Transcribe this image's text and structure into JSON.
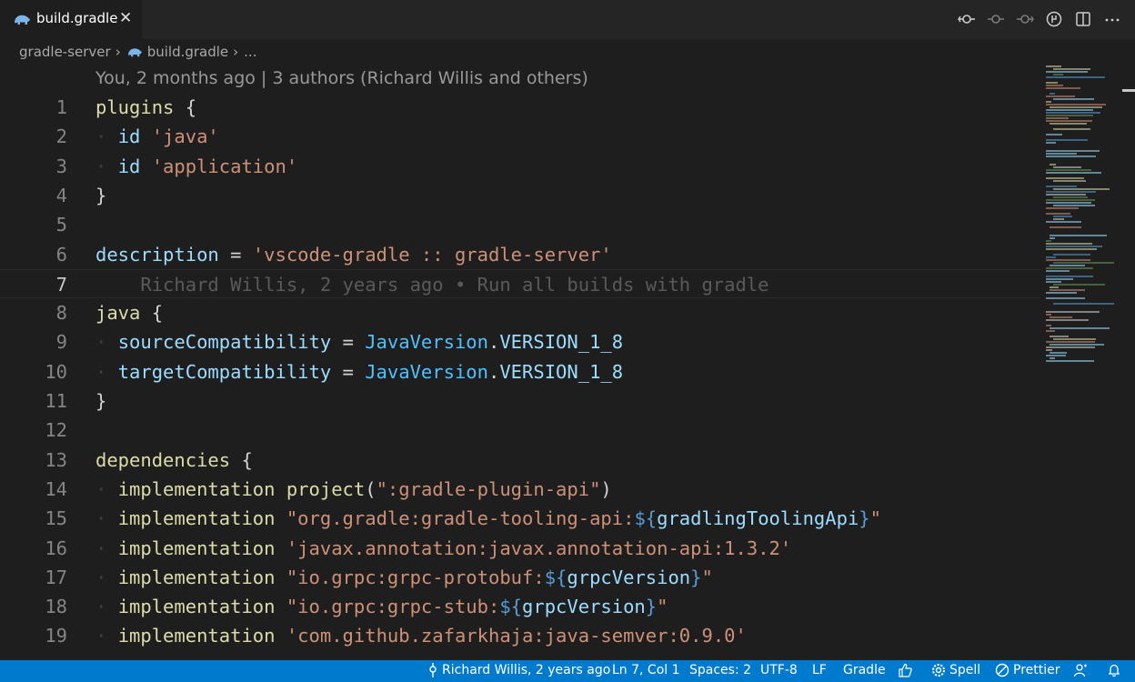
{
  "tab": {
    "label": "build.gradle",
    "close": "✕"
  },
  "breadcrumb": {
    "folder": "gradle-server",
    "file": "build.gradle",
    "more": "..."
  },
  "codelens": "You, 2 months ago | 3 authors (Richard Willis and others)",
  "current_line_blame": "Richard Willis, 2 years ago • Run all builds with gradle",
  "lines": [
    {
      "n": "1",
      "tokens": [
        [
          "kw",
          "plugins"
        ],
        [
          "punc",
          " {"
        ]
      ]
    },
    {
      "n": "2",
      "tokens": [
        [
          "dot",
          "· "
        ],
        [
          "prop",
          "id"
        ],
        [
          "punc",
          " "
        ],
        [
          "str",
          "'java'"
        ]
      ]
    },
    {
      "n": "3",
      "tokens": [
        [
          "dot",
          "· "
        ],
        [
          "prop",
          "id"
        ],
        [
          "punc",
          " "
        ],
        [
          "str",
          "'application'"
        ]
      ]
    },
    {
      "n": "4",
      "tokens": [
        [
          "punc",
          "}"
        ]
      ]
    },
    {
      "n": "5",
      "tokens": []
    },
    {
      "n": "6",
      "tokens": [
        [
          "prop",
          "description"
        ],
        [
          "op",
          " = "
        ],
        [
          "str",
          "'vscode-gradle :: gradle-server'"
        ]
      ]
    },
    {
      "n": "7",
      "tokens": []
    },
    {
      "n": "8",
      "tokens": [
        [
          "kw",
          "java"
        ],
        [
          "punc",
          " {"
        ]
      ]
    },
    {
      "n": "9",
      "tokens": [
        [
          "dot",
          "· "
        ],
        [
          "prop",
          "sourceCompatibility"
        ],
        [
          "op",
          " = "
        ],
        [
          "cls",
          "JavaVersion"
        ],
        [
          "punc",
          "."
        ],
        [
          "prop",
          "VERSION_1_8"
        ]
      ]
    },
    {
      "n": "10",
      "tokens": [
        [
          "dot",
          "· "
        ],
        [
          "prop",
          "targetCompatibility"
        ],
        [
          "op",
          " = "
        ],
        [
          "cls",
          "JavaVersion"
        ],
        [
          "punc",
          "."
        ],
        [
          "prop",
          "VERSION_1_8"
        ]
      ]
    },
    {
      "n": "11",
      "tokens": [
        [
          "punc",
          "}"
        ]
      ]
    },
    {
      "n": "12",
      "tokens": []
    },
    {
      "n": "13",
      "tokens": [
        [
          "kw",
          "dependencies"
        ],
        [
          "punc",
          " {"
        ]
      ]
    },
    {
      "n": "14",
      "tokens": [
        [
          "dot",
          "· "
        ],
        [
          "kw",
          "implementation"
        ],
        [
          "punc",
          " "
        ],
        [
          "kw",
          "project"
        ],
        [
          "punc",
          "("
        ],
        [
          "str",
          "\":gradle-plugin-api\""
        ],
        [
          "punc",
          ")"
        ]
      ]
    },
    {
      "n": "15",
      "tokens": [
        [
          "dot",
          "· "
        ],
        [
          "kw",
          "implementation"
        ],
        [
          "punc",
          " "
        ],
        [
          "str",
          "\"org.gradle:gradle-tooling-api:"
        ],
        [
          "tpl",
          "${"
        ],
        [
          "prop",
          "gradlingToolingApi"
        ],
        [
          "tpl",
          "}"
        ],
        [
          "str",
          "\""
        ]
      ]
    },
    {
      "n": "16",
      "tokens": [
        [
          "dot",
          "· "
        ],
        [
          "kw",
          "implementation"
        ],
        [
          "punc",
          " "
        ],
        [
          "str",
          "'javax.annotation:javax.annotation-api:1.3.2'"
        ]
      ]
    },
    {
      "n": "17",
      "tokens": [
        [
          "dot",
          "· "
        ],
        [
          "kw",
          "implementation"
        ],
        [
          "punc",
          " "
        ],
        [
          "str",
          "\"io.grpc:grpc-protobuf:"
        ],
        [
          "tpl",
          "${"
        ],
        [
          "prop",
          "grpcVersion"
        ],
        [
          "tpl",
          "}"
        ],
        [
          "str",
          "\""
        ]
      ]
    },
    {
      "n": "18",
      "tokens": [
        [
          "dot",
          "· "
        ],
        [
          "kw",
          "implementation"
        ],
        [
          "punc",
          " "
        ],
        [
          "str",
          "\"io.grpc:grpc-stub:"
        ],
        [
          "tpl",
          "${"
        ],
        [
          "prop",
          "grpcVersion"
        ],
        [
          "tpl",
          "}"
        ],
        [
          "str",
          "\""
        ]
      ]
    },
    {
      "n": "19",
      "tokens": [
        [
          "dot",
          "· "
        ],
        [
          "kw",
          "implementation"
        ],
        [
          "punc",
          " "
        ],
        [
          "str",
          "'com.github.zafarkhaja:java-semver:0.9.0'"
        ]
      ]
    }
  ],
  "statusbar": {
    "blame": "Richard Willis, 2 years ago",
    "position": "Ln 7, Col 1",
    "spaces": "Spaces: 2",
    "encoding": "UTF-8",
    "eol": "LF",
    "language": "Gradle",
    "spell": "Spell",
    "prettier": "Prettier"
  },
  "colors": {
    "accent": "#007acc",
    "keyword": "#dcdcaa",
    "property": "#9cdcfe",
    "string": "#ce9178",
    "template": "#569cd6"
  },
  "icons": {
    "tab_file": "gradle-elephant-icon",
    "actions": [
      "git-compare-icon",
      "git-commit-prev-icon",
      "git-commit-next-icon",
      "git-history-icon",
      "split-editor-icon",
      "more-actions-icon"
    ],
    "status": [
      "git-commit-icon",
      "thumbs-up-icon",
      "gear-icon",
      "prettier-icon",
      "person-icon",
      "bell-icon"
    ]
  }
}
